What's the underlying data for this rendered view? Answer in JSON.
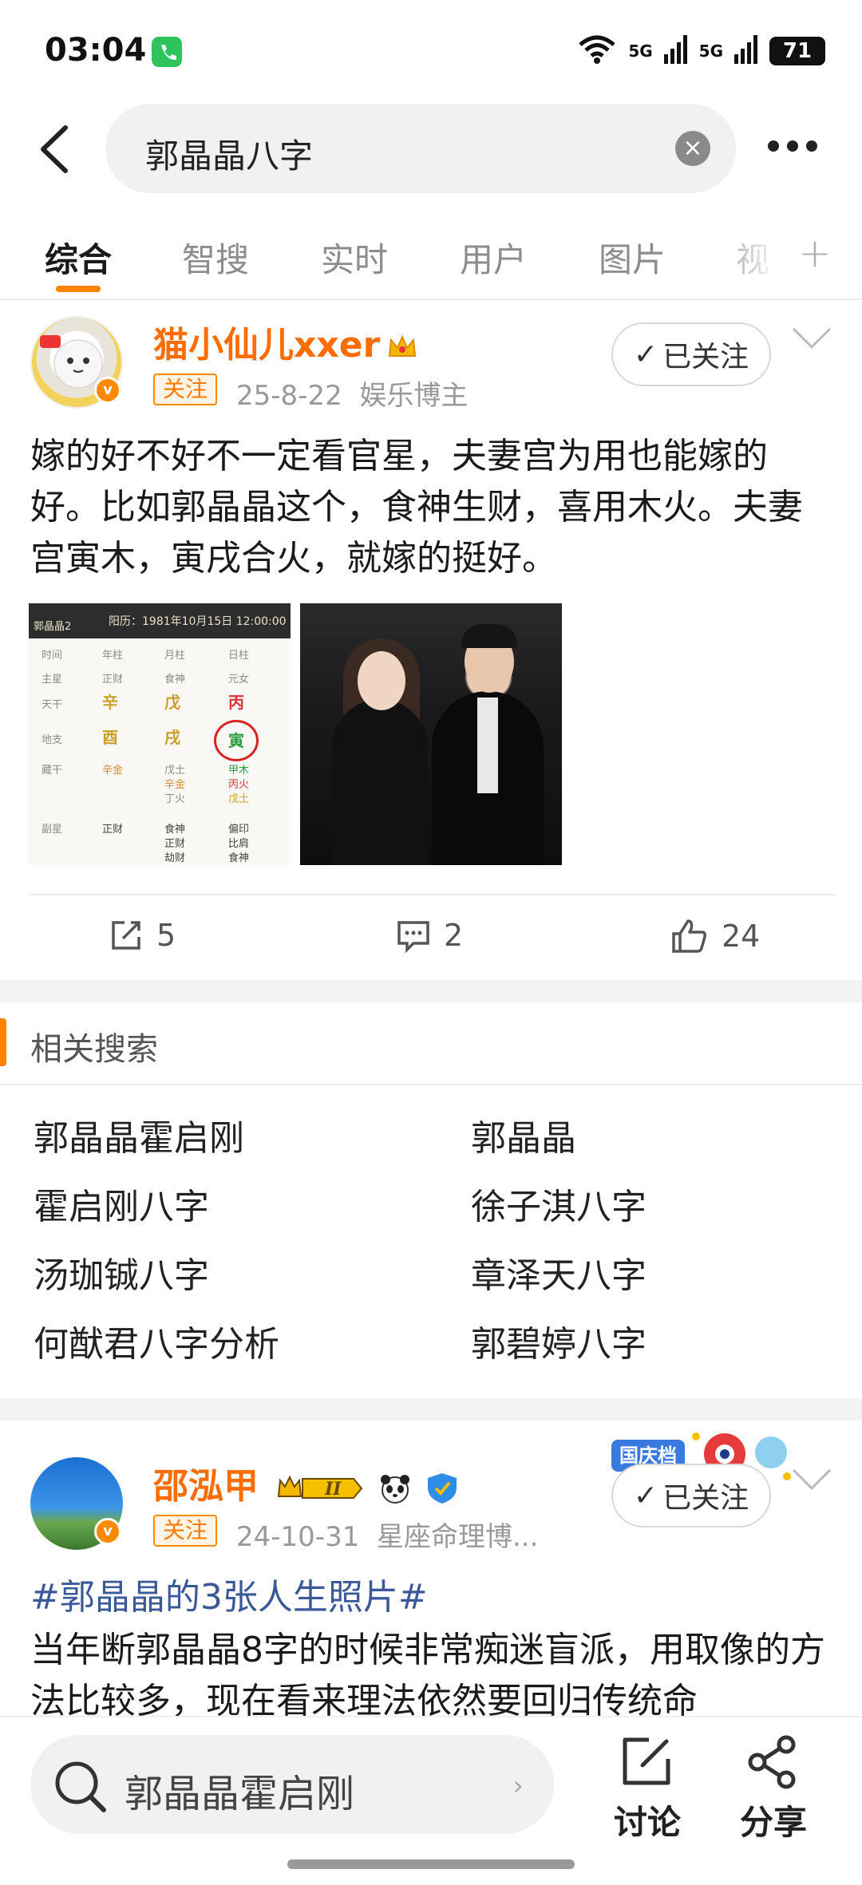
{
  "status_bar": {
    "time": "03:04",
    "network_1": "5G",
    "network_2": "5G",
    "battery": "71"
  },
  "header": {
    "search_query": "郭晶晶八字"
  },
  "tabs": [
    "综合",
    "智搜",
    "实时",
    "用户",
    "图片",
    "视"
  ],
  "posts": [
    {
      "username": "猫小仙儿xxer",
      "follow_tag": "关注",
      "date": "25-8-22",
      "category": "娱乐博主",
      "follow_button": "已关注",
      "text": "嫁的好不好不一定看官星，夫妻宫为用也能嫁的好。比如郭晶晶这个，食神生财，喜用木火。夫妻宫寅木，寅戌合火，就嫁的挺好。",
      "chart_image": {
        "label": "郭晶晶2",
        "calendar": "阳历：1981年10月15日 12:00:00",
        "row_labels": [
          "时间",
          "主星",
          "天干",
          "地支",
          "藏干",
          "副星"
        ],
        "col_labels": [
          "年柱",
          "月柱",
          "日柱"
        ],
        "main_stars": [
          "正财",
          "食神",
          "元女"
        ],
        "stems": [
          "辛",
          "戊",
          "丙"
        ],
        "branches": [
          "酉",
          "戌",
          "寅"
        ],
        "hidden_year": "辛金",
        "hidden_month": [
          "戊土",
          "辛金",
          "丁火"
        ],
        "hidden_day": [
          "甲木",
          "丙火",
          "戊土"
        ],
        "sub_year": "正财",
        "sub_month": [
          "食神",
          "正财",
          "劫财"
        ],
        "sub_day": [
          "偏印",
          "比肩",
          "食神"
        ]
      },
      "reposts": "5",
      "comments": "2",
      "likes": "24"
    },
    {
      "username": "邵泓甲",
      "level_badge": "II",
      "follow_tag": "关注",
      "date": "24-10-31",
      "category": "星座命理博...",
      "follow_button": "已关注",
      "festive_label": "国庆档",
      "hashtag": "#郭晶晶的3张人生照片#",
      "text": "当年断郭晶晶8字的时候非常痴迷盲派，用取像的方法比较多，现在看来理法依然要回归传统命"
    }
  ],
  "related": {
    "title": "相关搜索",
    "items": [
      "郭晶晶霍启刚",
      "郭晶晶",
      "霍启刚八字",
      "徐子淇八字",
      "汤珈铖八字",
      "章泽天八字",
      "何猷君八字分析",
      "郭碧婷八字"
    ]
  },
  "bottom_bar": {
    "search_text": "郭晶晶霍启刚",
    "discuss_label": "讨论",
    "share_label": "分享"
  },
  "colors": {
    "accent": "#ff8200",
    "username": "#ff6c00",
    "hashtag": "#3b5998"
  }
}
